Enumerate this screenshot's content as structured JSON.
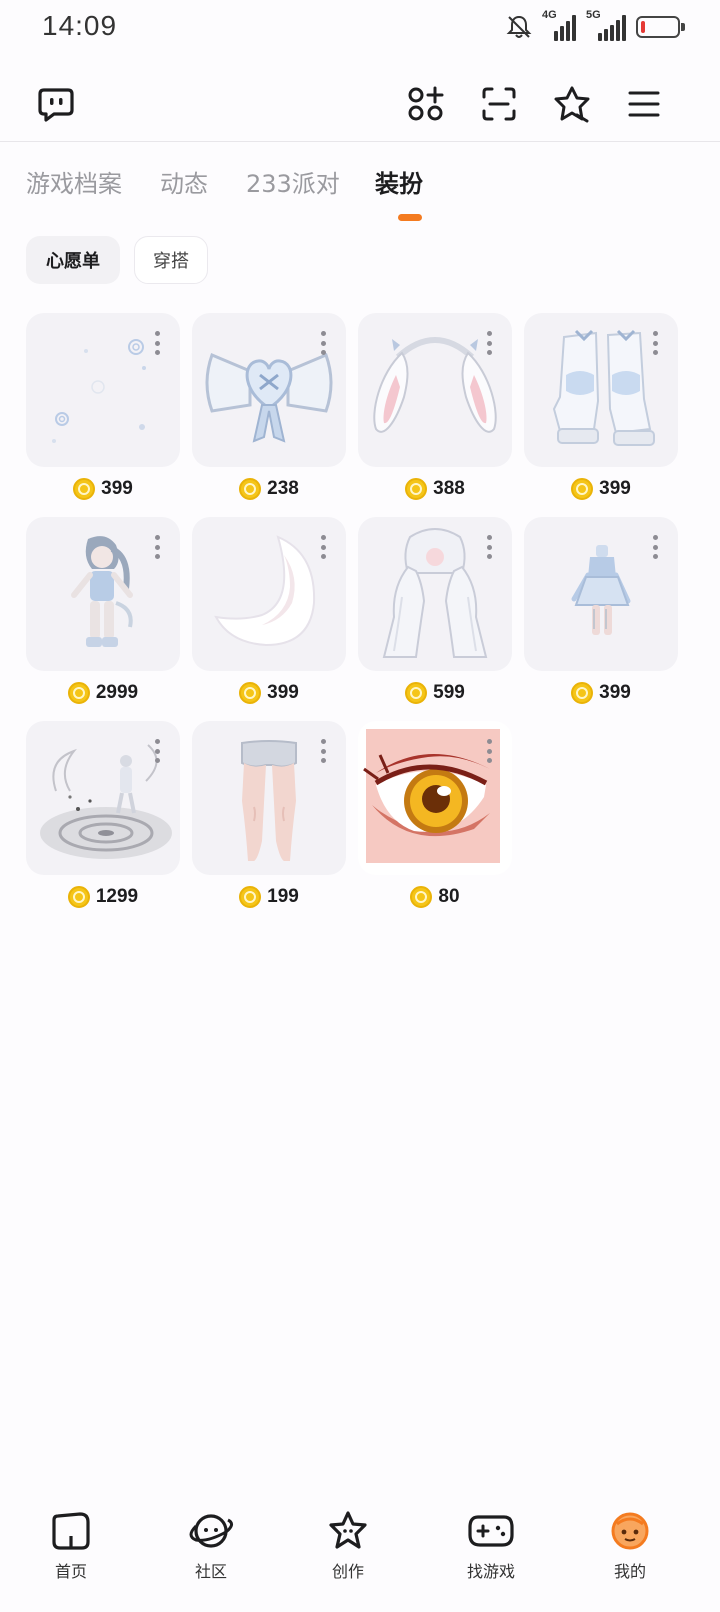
{
  "status_bar": {
    "time": "14:09",
    "network_1": "4G",
    "network_2": "5G",
    "battery_color": "#e53935"
  },
  "toolbar": {
    "icons": [
      "chat-bubble-icon",
      "add-apps-icon",
      "scan-icon",
      "star-badge-icon",
      "menu-icon"
    ]
  },
  "tabs": [
    {
      "label": "游戏档案",
      "active": false
    },
    {
      "label": "动态",
      "active": false
    },
    {
      "label": "233派对",
      "active": false
    },
    {
      "label": "装扮",
      "active": true
    }
  ],
  "chips": [
    {
      "label": "心愿单",
      "active": true
    },
    {
      "label": "穿搭",
      "active": false
    }
  ],
  "items": [
    {
      "price": "399",
      "thumb": "sparkle-effect"
    },
    {
      "price": "238",
      "thumb": "heart-bow-accessory"
    },
    {
      "price": "388",
      "thumb": "bunny-ears"
    },
    {
      "price": "399",
      "thumb": "white-boots"
    },
    {
      "price": "2999",
      "thumb": "full-outfit-avatar"
    },
    {
      "price": "399",
      "thumb": "white-tail"
    },
    {
      "price": "599",
      "thumb": "long-white-hair"
    },
    {
      "price": "399",
      "thumb": "blue-dress-outfit"
    },
    {
      "price": "1299",
      "thumb": "swirl-pedestal-effect"
    },
    {
      "price": "199",
      "thumb": "legs-shorts"
    },
    {
      "price": "80",
      "thumb": "yellow-eye"
    }
  ],
  "bottom_nav": [
    {
      "label": "首页",
      "icon": "home-icon",
      "active": false
    },
    {
      "label": "社区",
      "icon": "planet-icon",
      "active": false
    },
    {
      "label": "创作",
      "icon": "star-face-icon",
      "active": false
    },
    {
      "label": "找游戏",
      "icon": "gamepad-icon",
      "active": false
    },
    {
      "label": "我的",
      "icon": "avatar-face-icon",
      "active": true
    }
  ],
  "colors": {
    "accent": "#f47b20",
    "coin": "#f5c518",
    "background": "#fdfcfe"
  }
}
